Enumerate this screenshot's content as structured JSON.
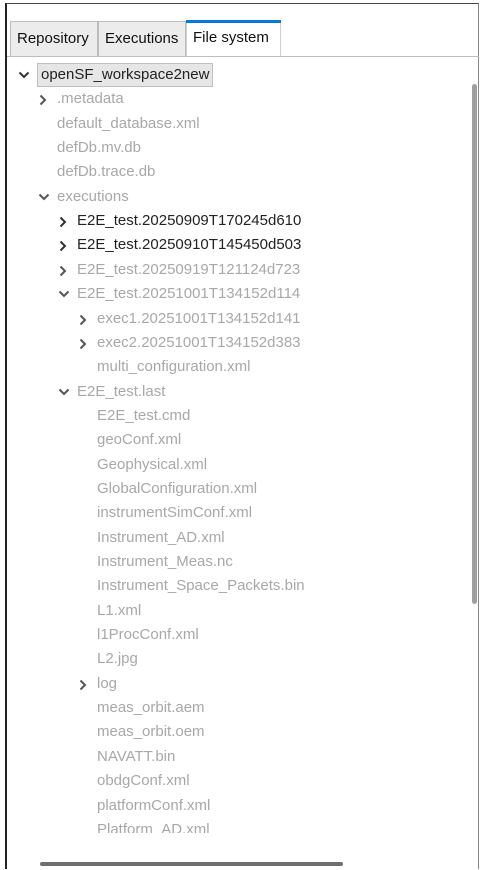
{
  "tabs": [
    "Repository",
    "Executions",
    "File system"
  ],
  "tree": [
    {
      "label": "openSF_workspace2new",
      "depth": 0,
      "chevron": "down",
      "tone": "d",
      "selected": true
    },
    {
      "label": ".metadata",
      "depth": 1,
      "chevron": "right",
      "tone": "g"
    },
    {
      "label": "default_database.xml",
      "depth": 1,
      "chevron": "none",
      "tone": "g"
    },
    {
      "label": "defDb.mv.db",
      "depth": 1,
      "chevron": "none",
      "tone": "g"
    },
    {
      "label": "defDb.trace.db",
      "depth": 1,
      "chevron": "none",
      "tone": "g"
    },
    {
      "label": "executions",
      "depth": 1,
      "chevron": "down",
      "tone": "g"
    },
    {
      "label": "E2E_test.20250909T170245d610",
      "depth": 2,
      "chevron": "right",
      "tone": "d"
    },
    {
      "label": "E2E_test.20250910T145450d503",
      "depth": 2,
      "chevron": "right",
      "tone": "d"
    },
    {
      "label": "E2E_test.20250919T121124d723",
      "depth": 2,
      "chevron": "right",
      "tone": "g"
    },
    {
      "label": "E2E_test.20251001T134152d114",
      "depth": 2,
      "chevron": "down",
      "tone": "g"
    },
    {
      "label": "exec1.20251001T134152d141",
      "depth": 3,
      "chevron": "right",
      "tone": "g"
    },
    {
      "label": "exec2.20251001T134152d383",
      "depth": 3,
      "chevron": "right",
      "tone": "g"
    },
    {
      "label": "multi_configuration.xml",
      "depth": 3,
      "chevron": "none",
      "tone": "g"
    },
    {
      "label": "E2E_test.last",
      "depth": 2,
      "chevron": "down",
      "tone": "g"
    },
    {
      "label": "E2E_test.cmd",
      "depth": 3,
      "chevron": "none",
      "tone": "g"
    },
    {
      "label": "geoConf.xml",
      "depth": 3,
      "chevron": "none",
      "tone": "g"
    },
    {
      "label": "Geophysical.xml",
      "depth": 3,
      "chevron": "none",
      "tone": "g"
    },
    {
      "label": "GlobalConfiguration.xml",
      "depth": 3,
      "chevron": "none",
      "tone": "g"
    },
    {
      "label": "instrumentSimConf.xml",
      "depth": 3,
      "chevron": "none",
      "tone": "g"
    },
    {
      "label": "Instrument_AD.xml",
      "depth": 3,
      "chevron": "none",
      "tone": "g"
    },
    {
      "label": "Instrument_Meas.nc",
      "depth": 3,
      "chevron": "none",
      "tone": "g"
    },
    {
      "label": "Instrument_Space_Packets.bin",
      "depth": 3,
      "chevron": "none",
      "tone": "g"
    },
    {
      "label": "L1.xml",
      "depth": 3,
      "chevron": "none",
      "tone": "g"
    },
    {
      "label": "l1ProcConf.xml",
      "depth": 3,
      "chevron": "none",
      "tone": "g"
    },
    {
      "label": "L2.jpg",
      "depth": 3,
      "chevron": "none",
      "tone": "g"
    },
    {
      "label": "log",
      "depth": 3,
      "chevron": "right",
      "tone": "g"
    },
    {
      "label": "meas_orbit.aem",
      "depth": 3,
      "chevron": "none",
      "tone": "g"
    },
    {
      "label": "meas_orbit.oem",
      "depth": 3,
      "chevron": "none",
      "tone": "g"
    },
    {
      "label": "NAVATT.bin",
      "depth": 3,
      "chevron": "none",
      "tone": "g"
    },
    {
      "label": "obdgConf.xml",
      "depth": 3,
      "chevron": "none",
      "tone": "g"
    },
    {
      "label": "platformConf.xml",
      "depth": 3,
      "chevron": "none",
      "tone": "g"
    },
    {
      "label": "Platform_AD.xml",
      "depth": 3,
      "chevron": "none",
      "tone": "g"
    }
  ]
}
